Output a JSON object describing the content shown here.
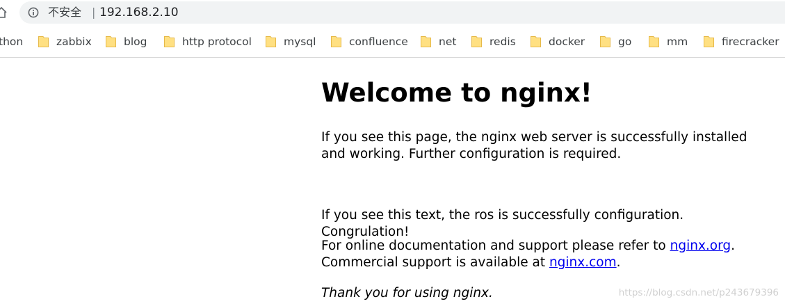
{
  "browser": {
    "security_label": "不安全",
    "separator": "|",
    "url": "192.168.2.10"
  },
  "bookmarks": [
    {
      "label": "thon",
      "icon": "folder-icon",
      "has_icon": false
    },
    {
      "label": "zabbix",
      "icon": "folder-icon"
    },
    {
      "label": "blog",
      "icon": "folder-icon"
    },
    {
      "label": "http protocol",
      "icon": "folder-icon"
    },
    {
      "label": "mysql",
      "icon": "folder-icon"
    },
    {
      "label": "confluence",
      "icon": "folder-icon"
    },
    {
      "label": "net",
      "icon": "folder-icon"
    },
    {
      "label": "redis",
      "icon": "folder-icon"
    },
    {
      "label": "docker",
      "icon": "folder-icon"
    },
    {
      "label": "go",
      "icon": "folder-icon"
    },
    {
      "label": "mm",
      "icon": "folder-icon"
    },
    {
      "label": "firecracker",
      "icon": "folder-icon"
    }
  ],
  "page": {
    "heading": "Welcome to nginx!",
    "p1": "If you see this page, the nginx web server is successfully installed and working. Further configuration is required.",
    "p2": "If you see this text, the ros is successfully configuration. Congrulation!",
    "p3_before": "For online documentation and support please refer to ",
    "p3_link1": "nginx.org",
    "p3_mid": ".",
    "p3_line2": "Commercial support is available at ",
    "p3_link2": "nginx.com",
    "p3_end": ".",
    "p4": "Thank you for using nginx."
  },
  "watermark": "https://blog.csdn.net/p243679396",
  "colors": {
    "link": "#0000ee",
    "folder": "#ffe082",
    "omnibox_bg": "#f1f3f4"
  }
}
